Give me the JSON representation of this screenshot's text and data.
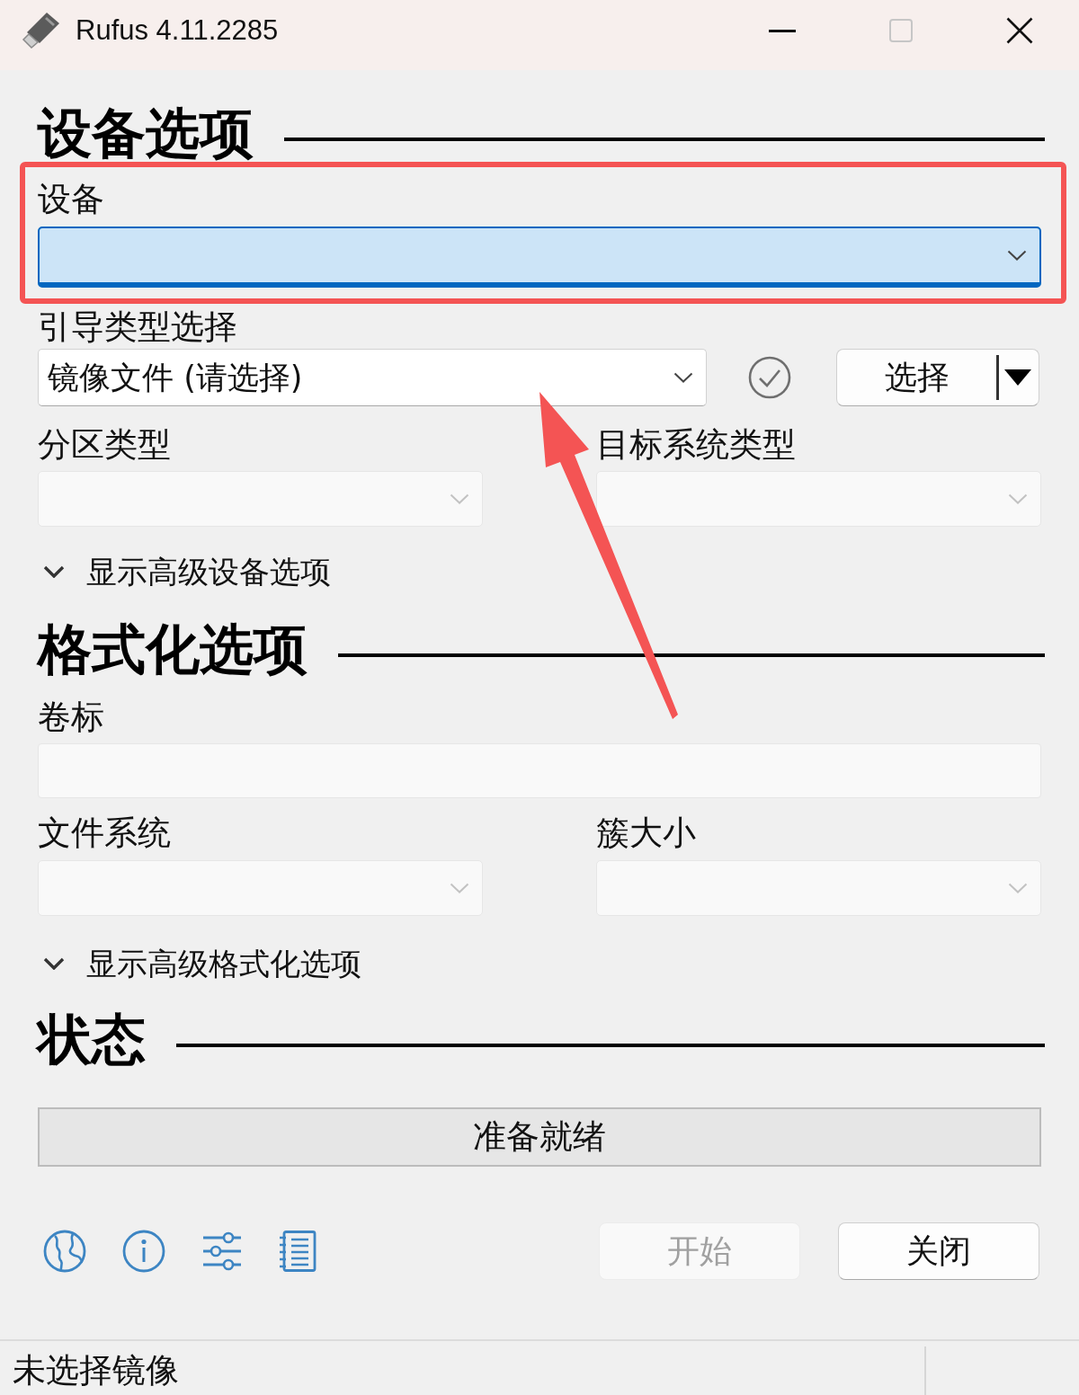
{
  "window": {
    "title": "Rufus 4.11.2285",
    "maximize_disabled": true
  },
  "device_options": {
    "heading": "设备选项",
    "device": {
      "label": "设备",
      "focused": true,
      "disabled": false
    },
    "boot_selection": {
      "label": "引导类型选择",
      "value": "镜像文件 (请选择)",
      "disabled": false
    },
    "select_button": {
      "label": "选择"
    },
    "partition_scheme": {
      "label": "分区类型",
      "disabled": true
    },
    "target_system": {
      "label": "目标系统类型",
      "disabled": true
    },
    "advanced_toggle": {
      "label": "显示高级设备选项",
      "expanded": false
    }
  },
  "format_options": {
    "heading": "格式化选项",
    "volume_label": {
      "label": "卷标",
      "disabled": true
    },
    "file_system": {
      "label": "文件系统",
      "disabled": true
    },
    "cluster_size": {
      "label": "簇大小",
      "disabled": true
    },
    "advanced_toggle": {
      "label": "显示高级格式化选项",
      "expanded": false
    }
  },
  "status": {
    "heading": "状态",
    "message": "准备就绪"
  },
  "buttons": [
    {
      "label": "开始",
      "disabled": true
    },
    {
      "label": "关闭",
      "disabled": false
    }
  ],
  "status_bar": {
    "text": "未选择镜像"
  }
}
